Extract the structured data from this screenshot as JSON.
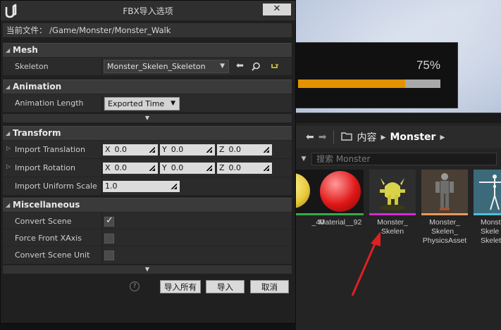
{
  "dialog": {
    "title": "FBX导入选项",
    "close_glyph": "✕",
    "current_file": "当前文件：  /Game/Monster/Monster_Walk"
  },
  "sections": {
    "mesh": {
      "title": "Mesh",
      "skeleton_label": "Skeleton",
      "skeleton_value": "Monster_Skelen_Skeleton",
      "icons": [
        "left-arrow-icon",
        "search-icon",
        "reset-icon"
      ]
    },
    "animation": {
      "title": "Animation",
      "length_label": "Animation Length",
      "length_value": "Exported Time"
    },
    "transform": {
      "title": "Transform",
      "translation_label": "Import Translation",
      "rotation_label": "Import Rotation",
      "scale_label": "Import Uniform Scale",
      "translation": {
        "x": "0.0",
        "y": "0.0",
        "z": "0.0"
      },
      "rotation": {
        "x": "0.0",
        "y": "0.0",
        "z": "0.0"
      },
      "scale": "1.0",
      "axis_labels": {
        "x": "X",
        "y": "Y",
        "z": "Z"
      }
    },
    "misc": {
      "title": "Miscellaneous",
      "convert_scene_label": "Convert Scene",
      "convert_scene": true,
      "force_front_label": "Force Front XAxis",
      "force_front": false,
      "convert_unit_label": "Convert Scene Unit",
      "convert_unit": false
    }
  },
  "buttons": {
    "import_all": "导入所有",
    "import": "导入",
    "cancel": "取消",
    "help_glyph": "?"
  },
  "progress": {
    "percent_text": "75%",
    "fraction": 0.75
  },
  "content_browser": {
    "crumb_content": "内容",
    "crumb_monster": "Monster",
    "search_placeholder": "搜索 Monster",
    "assets": [
      {
        "name": "_40"
      },
      {
        "name": "Material__92"
      },
      {
        "name": "Monster_ Skelen"
      },
      {
        "name": "Monster_ Skelen_ PhysicsAsset"
      },
      {
        "name": "Monst Skele Skelet"
      }
    ]
  },
  "colors": {
    "accent_orange": "#e29300",
    "dialog_bg": "#202020",
    "annotation_red": "#e02020"
  }
}
